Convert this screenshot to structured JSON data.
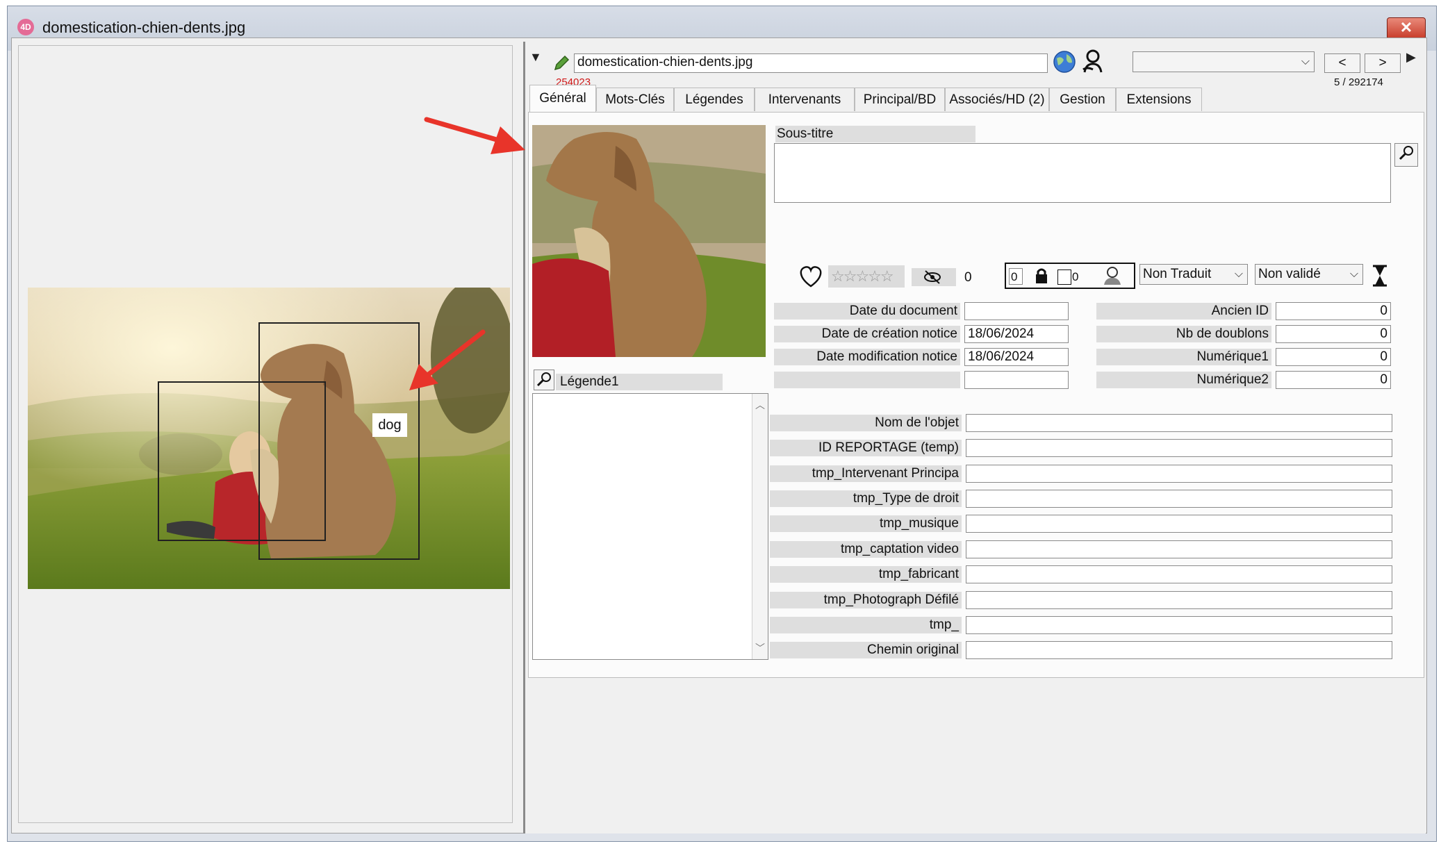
{
  "window": {
    "title": "domestication-chien-dents.jpg",
    "close_label": "✕"
  },
  "preview": {
    "detection_label": "dog"
  },
  "header": {
    "filename": "domestication-chien-dents.jpg",
    "record_id": "254023",
    "prev_label": "<",
    "next_label": ">",
    "position": "5 / 292174",
    "dropdown_value": ""
  },
  "tabs": [
    {
      "label": "Général"
    },
    {
      "label": "Mots-Clés"
    },
    {
      "label": "Légendes"
    },
    {
      "label": "Intervenants"
    },
    {
      "label": "Principal/BD"
    },
    {
      "label": "Associés/HD  (2)"
    },
    {
      "label": "Gestion"
    },
    {
      "label": "Extensions"
    }
  ],
  "general": {
    "subtitle_label": "Sous-titre",
    "subtitle_value": "",
    "rating_stars": "☆☆☆☆☆",
    "views_count": "0",
    "lock_count": "0",
    "checkbox_count": "0",
    "translation_status": "Non Traduit",
    "validation_status": "Non validé",
    "legende_label": "Légende1",
    "dates": [
      {
        "label": "Date du document",
        "value": ""
      },
      {
        "label": "Date de création notice",
        "value": "18/06/2024"
      },
      {
        "label": "Date modification notice",
        "value": "18/06/2024"
      },
      {
        "label": "",
        "value": ""
      }
    ],
    "numbers": [
      {
        "label": "Ancien ID",
        "value": "0"
      },
      {
        "label": "Nb de doublons",
        "value": "0"
      },
      {
        "label": "Numérique1",
        "value": "0"
      },
      {
        "label": "Numérique2",
        "value": "0"
      }
    ],
    "fields": [
      {
        "label": "Nom de l'objet",
        "value": ""
      },
      {
        "label": "ID REPORTAGE (temp)",
        "value": ""
      },
      {
        "label": "tmp_Intervenant Principa",
        "value": ""
      },
      {
        "label": "tmp_Type de droit",
        "value": ""
      },
      {
        "label": "tmp_musique",
        "value": ""
      },
      {
        "label": "tmp_captation video",
        "value": ""
      },
      {
        "label": "tmp_fabricant",
        "value": ""
      },
      {
        "label": "tmp_Photograph Défilé",
        "value": ""
      },
      {
        "label": "tmp_",
        "value": ""
      },
      {
        "label": "Chemin original",
        "value": ""
      }
    ]
  },
  "colors": {
    "annotation_arrow": "#e8342a",
    "record_id": "#d01818",
    "window_title_bg": "#d7dde7"
  }
}
